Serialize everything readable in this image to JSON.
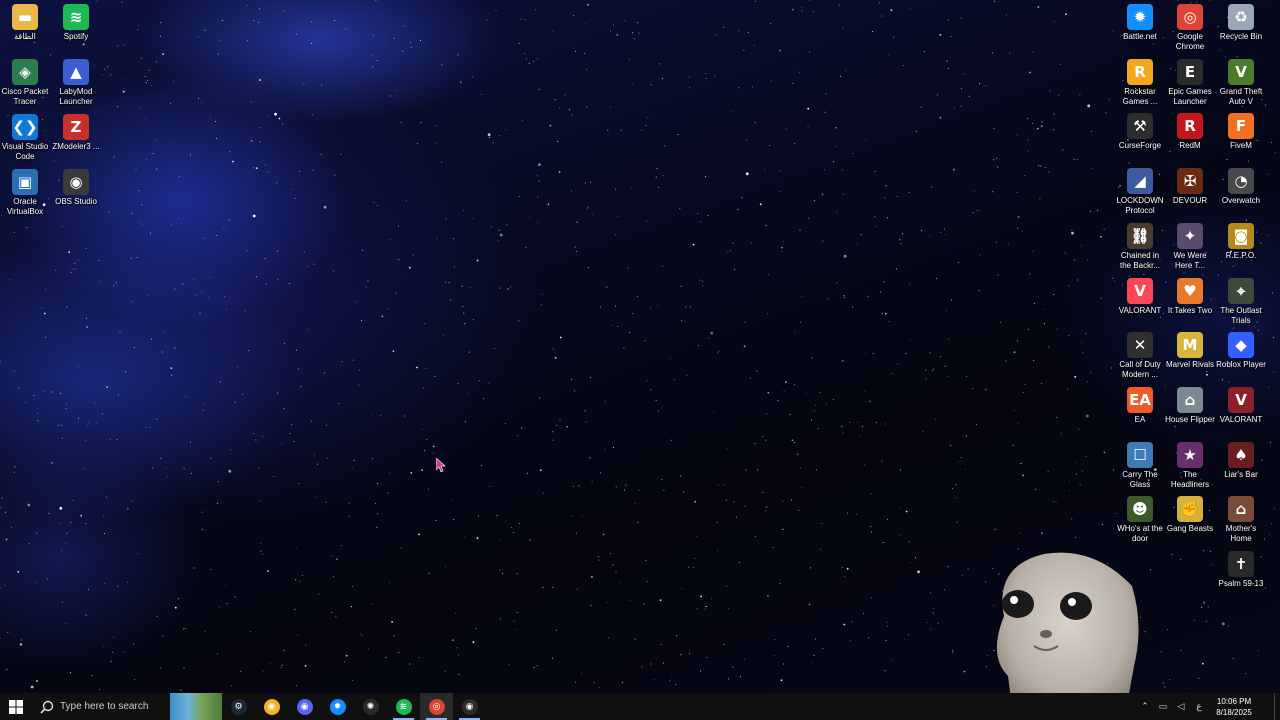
{
  "desktop": {
    "left_icons": [
      {
        "label": "الطاقة",
        "icon": "folder-icon",
        "color": "#e8b84a",
        "glyph": "▬"
      },
      {
        "label": "Spotify",
        "icon": "spotify-icon",
        "color": "#1db954",
        "glyph": "≋"
      },
      {
        "label": "Cisco Packet Tracer",
        "icon": "cisco-packet-tracer-icon",
        "color": "#2e7d4f",
        "glyph": "◈"
      },
      {
        "label": "LabyMod Launcher",
        "icon": "labymod-icon",
        "color": "#3a5fd0",
        "glyph": "▲"
      },
      {
        "label": "Visual Studio Code",
        "icon": "vscode-icon",
        "color": "#0e7ad6",
        "glyph": "❮❯"
      },
      {
        "label": "ZModeler3 ...",
        "icon": "zmodeler-icon",
        "color": "#c8302d",
        "glyph": "Z"
      },
      {
        "label": "Oracle VirtualBox",
        "icon": "virtualbox-icon",
        "color": "#2b6fb3",
        "glyph": "▣"
      },
      {
        "label": "OBS Studio",
        "icon": "obs-icon",
        "color": "#3a3a3a",
        "glyph": "◉"
      }
    ],
    "right_icons": [
      {
        "label": "Battle.net",
        "icon": "battlenet-icon",
        "color": "#148eff",
        "glyph": "✹"
      },
      {
        "label": "Google Chrome",
        "icon": "chrome-icon",
        "color": "#db4437",
        "glyph": "◎"
      },
      {
        "label": "Recycle Bin",
        "icon": "recycle-bin-icon",
        "color": "#9aa7b5",
        "glyph": "♻"
      },
      {
        "label": "Rockstar Games ...",
        "icon": "rockstar-icon",
        "color": "#f3a81a",
        "glyph": "R"
      },
      {
        "label": "Epic Games Launcher",
        "icon": "epic-games-icon",
        "color": "#2b2b2b",
        "glyph": "E"
      },
      {
        "label": "Grand Theft Auto V",
        "icon": "gta-v-icon",
        "color": "#4e7a2c",
        "glyph": "V"
      },
      {
        "label": "CurseForge",
        "icon": "curseforge-icon",
        "color": "#2d2d2d",
        "glyph": "⚒"
      },
      {
        "label": "RedM",
        "icon": "redm-icon",
        "color": "#c4161c",
        "glyph": "R"
      },
      {
        "label": "FiveM",
        "icon": "fivem-icon",
        "color": "#f37021",
        "glyph": "F"
      },
      {
        "label": "LOCKDOWN Protocol",
        "icon": "lockdown-protocol-icon",
        "color": "#3d5a9e",
        "glyph": "◢"
      },
      {
        "label": "DEVOUR",
        "icon": "devour-icon",
        "color": "#6b2a12",
        "glyph": "✠"
      },
      {
        "label": "Overwatch",
        "icon": "overwatch-icon",
        "color": "#4a4a4a",
        "glyph": "◔"
      },
      {
        "label": "Chained in the Backr...",
        "icon": "chained-icon",
        "color": "#4a3b2e",
        "glyph": "⛓"
      },
      {
        "label": "We Were Here T...",
        "icon": "we-were-here-icon",
        "color": "#5a4b6e",
        "glyph": "✦"
      },
      {
        "label": "R.E.P.O.",
        "icon": "repo-icon",
        "color": "#b58a1c",
        "glyph": "◙"
      },
      {
        "label": "VALORANT",
        "icon": "valorant-icon",
        "color": "#ff4655",
        "glyph": "V"
      },
      {
        "label": "It Takes Two",
        "icon": "it-takes-two-icon",
        "color": "#e8782a",
        "glyph": "♥"
      },
      {
        "label": "The Outlast Trials",
        "icon": "outlast-trials-icon",
        "color": "#3e4a3a",
        "glyph": "⌖"
      },
      {
        "label": "Call of Duty Modern ...",
        "icon": "call-of-duty-icon",
        "color": "#2f2f2f",
        "glyph": "✕"
      },
      {
        "label": "Marvel Rivals",
        "icon": "marvel-rivals-icon",
        "color": "#d7b53a",
        "glyph": "M"
      },
      {
        "label": "Roblox Player",
        "icon": "roblox-icon",
        "color": "#335fff",
        "glyph": "◆"
      },
      {
        "label": "EA",
        "icon": "ea-icon",
        "color": "#f05a28",
        "glyph": "EA"
      },
      {
        "label": "House Flipper",
        "icon": "house-flipper-icon",
        "color": "#7a8b8f",
        "glyph": "⌂"
      },
      {
        "label": "VALORANT",
        "icon": "valorant-alt-icon",
        "color": "#8c1f2a",
        "glyph": "V"
      },
      {
        "label": "Carry The Glass",
        "icon": "carry-the-glass-icon",
        "color": "#3e7ab5",
        "glyph": "☐"
      },
      {
        "label": "The Headliners",
        "icon": "headliners-icon",
        "color": "#6a2d6e",
        "glyph": "★"
      },
      {
        "label": "Liar's Bar",
        "icon": "liars-bar-icon",
        "color": "#6a1e1e",
        "glyph": "♠"
      },
      {
        "label": "WHo's at the door",
        "icon": "whos-at-the-door-icon",
        "color": "#3c5a2a",
        "glyph": "☻"
      },
      {
        "label": "Gang Beasts",
        "icon": "gang-beasts-icon",
        "color": "#d4b23a",
        "glyph": "✊"
      },
      {
        "label": "Mother's Home",
        "icon": "mothers-home-icon",
        "color": "#7a4a3a",
        "glyph": "⌂"
      },
      {
        "label": "Psalm 59-13",
        "icon": "psalm-icon",
        "color": "#2a2a2a",
        "glyph": "✝"
      }
    ]
  },
  "taskbar": {
    "search_placeholder": "Type here to search",
    "apps": [
      {
        "name": "steam-icon",
        "color": "#1b2838",
        "glyph": "⚙"
      },
      {
        "name": "discord-yellow-icon",
        "color": "#f0b429",
        "glyph": "◉"
      },
      {
        "name": "discord-icon",
        "color": "#5865f2",
        "glyph": "◉"
      },
      {
        "name": "battlenet-icon",
        "color": "#148eff",
        "glyph": "✹"
      },
      {
        "name": "steelseries-icon",
        "color": "#2a2a2a",
        "glyph": "✺"
      },
      {
        "name": "spotify-icon",
        "color": "#1db954",
        "glyph": "≋"
      },
      {
        "name": "chrome-icon",
        "color": "#db4437",
        "glyph": "◎"
      },
      {
        "name": "obs-icon",
        "color": "#2a2a2a",
        "glyph": "◉"
      }
    ],
    "clock": {
      "time": "10:06 PM",
      "date": "8/18/2025"
    },
    "language": "ع"
  }
}
